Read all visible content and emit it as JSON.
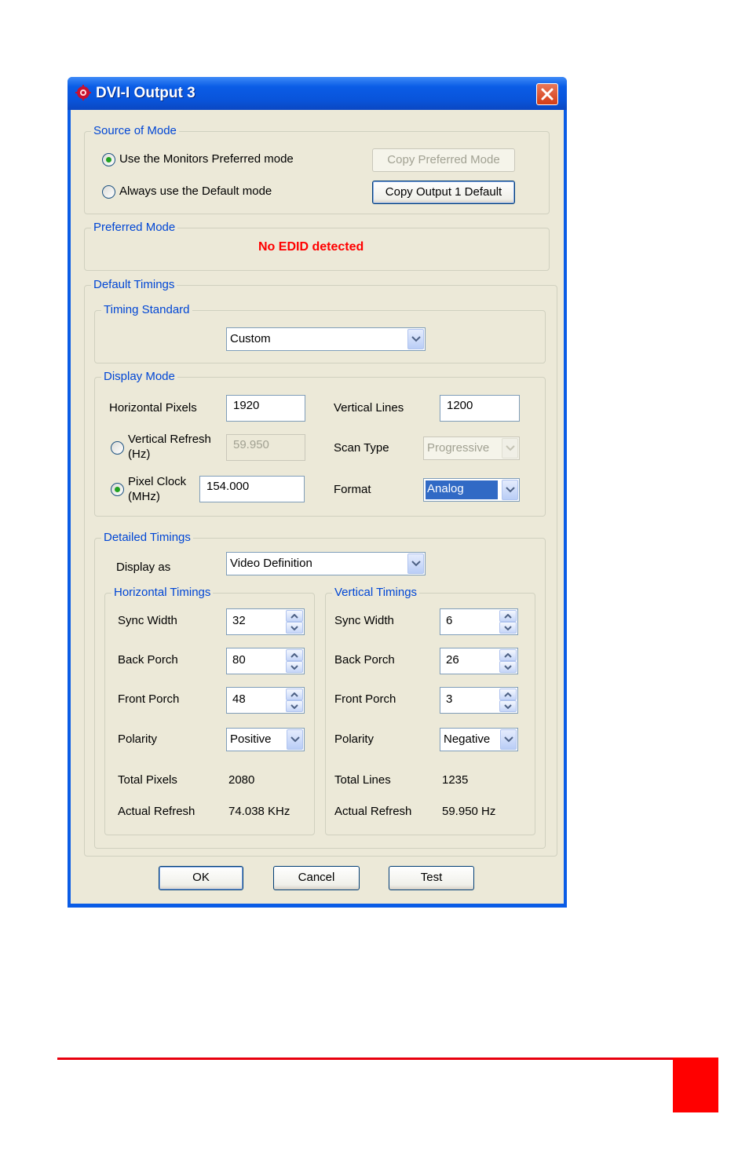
{
  "window": {
    "title": "DVI-I Output 3"
  },
  "source_of_mode": {
    "legend": "Source of Mode",
    "radio_preferred": "Use the Monitors Preferred mode",
    "radio_default": "Always use the Default mode",
    "selected": "preferred",
    "copy_preferred_btn": "Copy Preferred Mode",
    "copy_output_btn": "Copy Output 1 Default"
  },
  "preferred_mode": {
    "legend": "Preferred Mode",
    "status": "No EDID detected",
    "status_color": "#ff0000"
  },
  "default_timings": {
    "legend": "Default Timings",
    "timing_standard": {
      "legend": "Timing Standard",
      "value": "Custom"
    },
    "display_mode": {
      "legend": "Display Mode",
      "horizontal_pixels_label": "Horizontal Pixels",
      "horizontal_pixels": "1920",
      "vertical_lines_label": "Vertical Lines",
      "vertical_lines": "1200",
      "vertical_refresh_label_1": "Vertical Refresh",
      "vertical_refresh_label_2": "(Hz)",
      "vertical_refresh": "59.950",
      "scan_type_label": "Scan Type",
      "scan_type": "Progressive",
      "pixel_clock_label_1": "Pixel Clock",
      "pixel_clock_label_2": "(MHz)",
      "pixel_clock": "154.000",
      "format_label": "Format",
      "format": "Analog",
      "selected": "pixel_clock"
    },
    "detailed_timings": {
      "legend": "Detailed Timings",
      "display_as_label": "Display as",
      "display_as": "Video Definition",
      "horizontal": {
        "legend": "Horizontal Timings",
        "sync_width_label": "Sync Width",
        "sync_width": "32",
        "back_porch_label": "Back Porch",
        "back_porch": "80",
        "front_porch_label": "Front Porch",
        "front_porch": "48",
        "polarity_label": "Polarity",
        "polarity": "Positive",
        "total_label": "Total Pixels",
        "total": "2080",
        "actual_refresh_label": "Actual Refresh",
        "actual_refresh": "74.038 KHz"
      },
      "vertical": {
        "legend": "Vertical Timings",
        "sync_width_label": "Sync Width",
        "sync_width": "6",
        "back_porch_label": "Back Porch",
        "back_porch": "26",
        "front_porch_label": "Front Porch",
        "front_porch": "3",
        "polarity_label": "Polarity",
        "polarity": "Negative",
        "total_label": "Total Lines",
        "total": "1235",
        "actual_refresh_label": "Actual Refresh",
        "actual_refresh": "59.950 Hz"
      }
    }
  },
  "buttons": {
    "ok": "OK",
    "cancel": "Cancel",
    "test": "Test"
  },
  "icons": {
    "app": "red-gear-icon",
    "close": "close-icon",
    "dropdown": "chevron-down-icon",
    "spin_up": "arrow-up-icon",
    "spin_down": "arrow-down-icon"
  }
}
